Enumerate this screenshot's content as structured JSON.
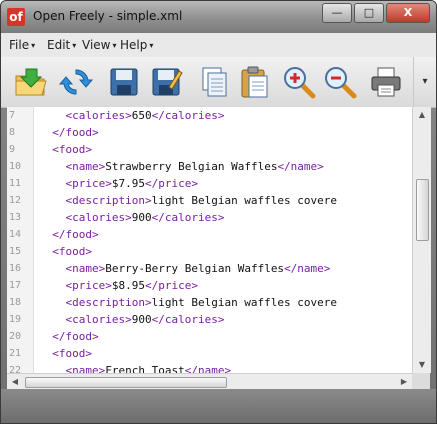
{
  "window": {
    "title": "Open Freely - simple.xml",
    "app_icon_text": "of",
    "controls": {
      "minimize": "—",
      "maximize": "□",
      "close": "X"
    }
  },
  "menubar": {
    "items": [
      {
        "label": "File"
      },
      {
        "label": "Edit"
      },
      {
        "label": "View"
      },
      {
        "label": "Help"
      }
    ],
    "caret": "▾"
  },
  "toolbar": {
    "buttons": [
      {
        "icon": "open-folder-icon"
      },
      {
        "icon": "refresh-icon"
      },
      {
        "icon": "save-icon"
      },
      {
        "icon": "save-as-icon"
      },
      {
        "icon": "copy-icon"
      },
      {
        "icon": "paste-icon"
      },
      {
        "icon": "zoom-in-icon"
      },
      {
        "icon": "zoom-out-icon"
      },
      {
        "icon": "print-icon"
      }
    ],
    "more": "▾"
  },
  "editor": {
    "lines": [
      {
        "n": "7",
        "indent": "    ",
        "open": "<calories>",
        "text": "650",
        "close": "</calories>"
      },
      {
        "n": "8",
        "indent": "  ",
        "open": "</food>",
        "text": "",
        "close": ""
      },
      {
        "n": "9",
        "indent": "  ",
        "open": "<food>",
        "text": "",
        "close": ""
      },
      {
        "n": "10",
        "indent": "    ",
        "open": "<name>",
        "text": "Strawberry Belgian Waffles",
        "close": "</name>"
      },
      {
        "n": "11",
        "indent": "    ",
        "open": "<price>",
        "text": "$7.95",
        "close": "</price>"
      },
      {
        "n": "12",
        "indent": "    ",
        "open": "<description>",
        "text": "light Belgian waffles covere",
        "close": ""
      },
      {
        "n": "13",
        "indent": "    ",
        "open": "<calories>",
        "text": "900",
        "close": "</calories>"
      },
      {
        "n": "14",
        "indent": "  ",
        "open": "</food>",
        "text": "",
        "close": ""
      },
      {
        "n": "15",
        "indent": "  ",
        "open": "<food>",
        "text": "",
        "close": ""
      },
      {
        "n": "16",
        "indent": "    ",
        "open": "<name>",
        "text": "Berry-Berry Belgian Waffles",
        "close": "</name>"
      },
      {
        "n": "17",
        "indent": "    ",
        "open": "<price>",
        "text": "$8.95",
        "close": "</price>"
      },
      {
        "n": "18",
        "indent": "    ",
        "open": "<description>",
        "text": "light Belgian waffles covere",
        "close": ""
      },
      {
        "n": "19",
        "indent": "    ",
        "open": "<calories>",
        "text": "900",
        "close": "</calories>"
      },
      {
        "n": "20",
        "indent": "  ",
        "open": "</food>",
        "text": "",
        "close": ""
      },
      {
        "n": "21",
        "indent": "  ",
        "open": "<food>",
        "text": "",
        "close": ""
      },
      {
        "n": "22",
        "indent": "    ",
        "open": "<name>",
        "text": "French Toast",
        "close": "</name>"
      }
    ]
  },
  "scrollbars": {
    "up": "▲",
    "down": "▼",
    "left": "◀",
    "right": "▶"
  },
  "colors": {
    "tag": "#7a1fa2",
    "text": "#111111",
    "line_numbers": "#9a9a9a"
  }
}
